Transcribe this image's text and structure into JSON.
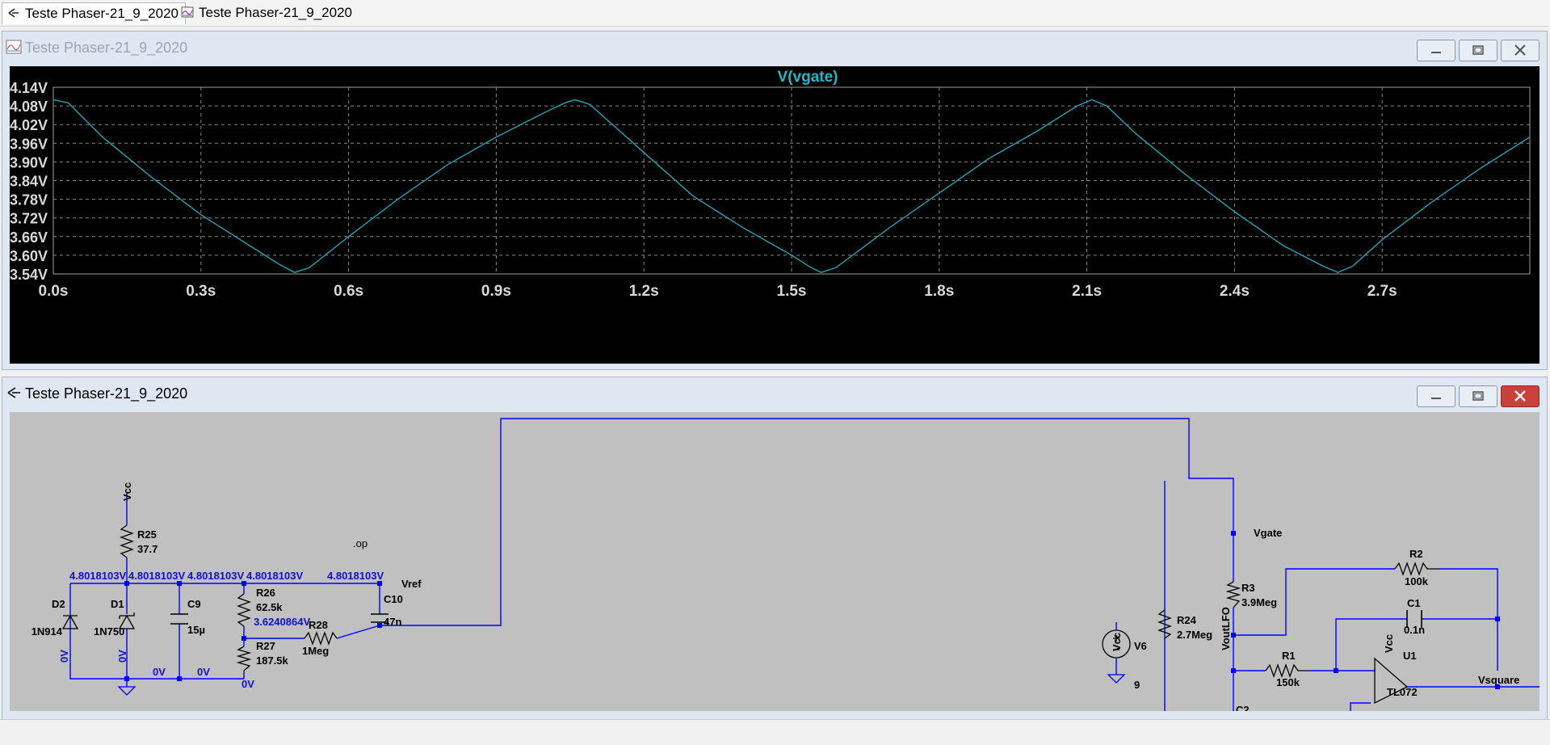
{
  "tabs": [
    {
      "label": "Teste Phaser-21_9_2020"
    },
    {
      "label": "Teste Phaser-21_9_2020"
    }
  ],
  "plot_window": {
    "title": "Teste Phaser-21_9_2020"
  },
  "schematic_window": {
    "title": "Teste Phaser-21_9_2020",
    "op_directive": ".op",
    "nets": {
      "vcc": "Vcc",
      "vref": "Vref",
      "vgate": "Vgate",
      "voutlfo": "VoutLFO",
      "vsquare": "Vsquare"
    },
    "components": {
      "R25": {
        "name": "R25",
        "value": "37.7"
      },
      "R26": {
        "name": "R26",
        "value": "62.5k"
      },
      "R27": {
        "name": "R27",
        "value": "187.5k"
      },
      "R28": {
        "name": "R28",
        "value": "1Meg"
      },
      "C9": {
        "name": "C9",
        "value": "15µ"
      },
      "C10": {
        "name": "C10",
        "value": "47n"
      },
      "D2": {
        "name": "D2",
        "value": "1N914"
      },
      "D1": {
        "name": "D1",
        "value": "1N750"
      },
      "R24": {
        "name": "R24",
        "value": "2.7Meg"
      },
      "V6": {
        "name": "V6",
        "value": "9"
      },
      "R3": {
        "name": "R3",
        "value": "3.9Meg"
      },
      "R2": {
        "name": "R2",
        "value": "100k"
      },
      "C1": {
        "name": "C1",
        "value": "0.1n"
      },
      "R1": {
        "name": "R1",
        "value": "150k"
      },
      "U1": {
        "name": "U1",
        "value": "TL072"
      },
      "C2": {
        "name": "C2"
      }
    },
    "voltages": {
      "n1": "4.8018103V",
      "n2": "4.8018103V",
      "n3": "4.8018103V",
      "n4": "4.8018103V",
      "n5": "4.8018103V",
      "n6": "3.6240864V",
      "d2": "0V",
      "d1": "0V",
      "gnd1": "0V",
      "gnd2": "0V",
      "gnd3": "0V"
    }
  },
  "colors": {
    "trace": "#1fa3b3",
    "grid": "#888888",
    "wire": "#0000ff",
    "label_voltage": "#1010d0",
    "close_button": "#c8423b"
  },
  "chart_data": {
    "type": "line",
    "title": "V(vgate)",
    "xlabel": "",
    "ylabel": "",
    "x_ticks": [
      "0.0s",
      "0.3s",
      "0.6s",
      "0.9s",
      "1.2s",
      "1.5s",
      "1.8s",
      "2.1s",
      "2.4s",
      "2.7s"
    ],
    "y_ticks": [
      "4.14V",
      "4.08V",
      "4.02V",
      "3.96V",
      "3.90V",
      "3.84V",
      "3.78V",
      "3.72V",
      "3.66V",
      "3.60V",
      "3.54V"
    ],
    "xlim": [
      0,
      3.0
    ],
    "ylim": [
      3.54,
      4.14
    ],
    "grid": true,
    "series": [
      {
        "name": "V(vgate)",
        "x": [
          0.0,
          0.03,
          0.1,
          0.2,
          0.3,
          0.4,
          0.46,
          0.49,
          0.52,
          0.6,
          0.7,
          0.8,
          0.9,
          1.0,
          1.04,
          1.06,
          1.09,
          1.2,
          1.3,
          1.4,
          1.5,
          1.54,
          1.56,
          1.59,
          1.7,
          1.8,
          1.9,
          2.0,
          2.08,
          2.11,
          2.14,
          2.2,
          2.3,
          2.4,
          2.5,
          2.58,
          2.61,
          2.64,
          2.7,
          2.8,
          2.9,
          3.0
        ],
        "y": [
          4.1,
          4.09,
          3.98,
          3.85,
          3.73,
          3.63,
          3.57,
          3.545,
          3.56,
          3.66,
          3.78,
          3.89,
          3.98,
          4.06,
          4.09,
          4.1,
          4.085,
          3.93,
          3.79,
          3.69,
          3.6,
          3.56,
          3.545,
          3.56,
          3.69,
          3.8,
          3.91,
          4.0,
          4.08,
          4.1,
          4.08,
          3.99,
          3.86,
          3.74,
          3.63,
          3.565,
          3.545,
          3.565,
          3.65,
          3.77,
          3.88,
          3.98
        ]
      }
    ]
  }
}
